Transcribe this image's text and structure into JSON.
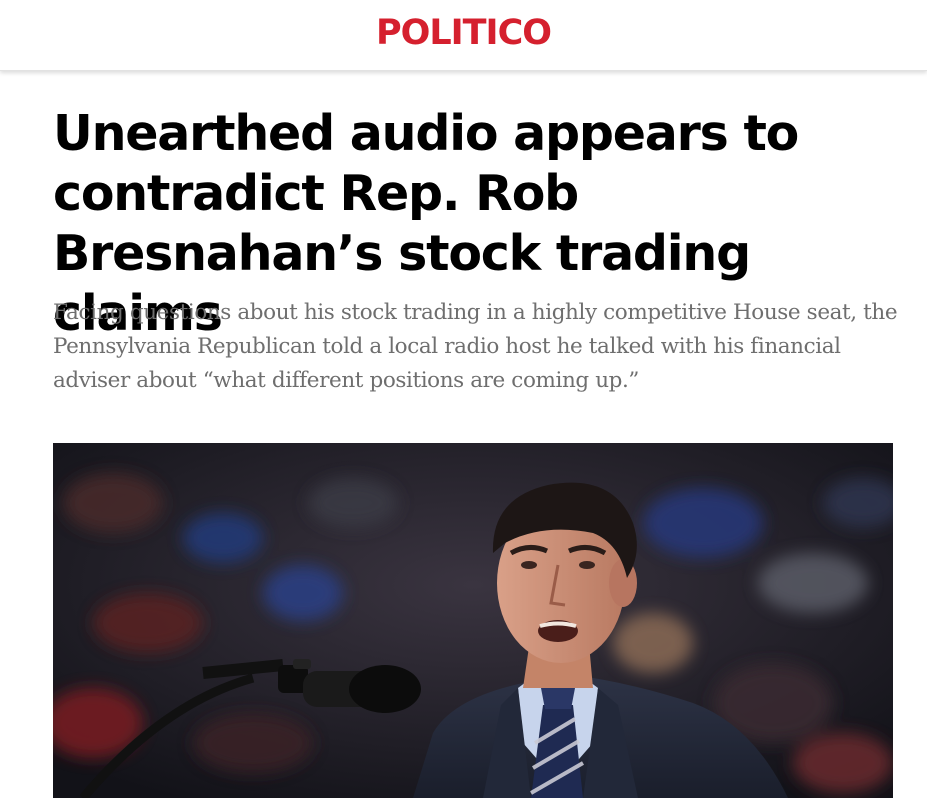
{
  "header": {
    "logo_text": "POLITICO",
    "brand_color": "#d5202e"
  },
  "article": {
    "headline": "Unearthed audio appears to contradict Rep. Rob Bresnahan’s stock trading claims",
    "dek": "Facing questions about his stock trading in a highly competitive House seat, the Pennsylvania Republican told a local radio host he talked with his financial adviser about “what different positions are coming up.”"
  },
  "lead_image": {
    "subject": "man in a dark suit and striped tie speaking into a microphone at a rally, blurred crowd behind"
  }
}
